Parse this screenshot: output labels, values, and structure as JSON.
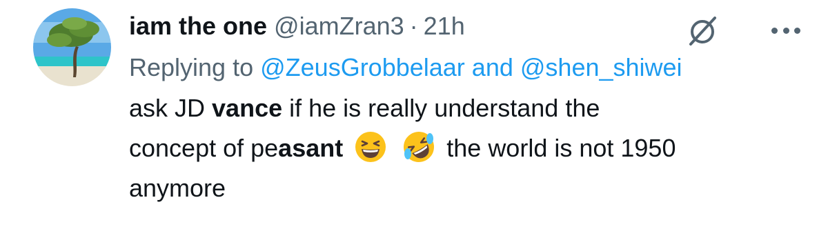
{
  "user": {
    "display_name": "iam the one",
    "handle": "@iamZran3",
    "separator": "·",
    "time": "21h"
  },
  "reply": {
    "prefix": "Replying to ",
    "mention1": "@ZeusGrobbelaar",
    "and": " and ",
    "mention2": "@shen_shiwei"
  },
  "body": {
    "t1": "ask JD ",
    "t2": "vance",
    "t3": " if he is really understand the",
    "t4": "concept of pe",
    "t5": "asant",
    "t6": " the world is not 1950",
    "t7": "anymore"
  },
  "icons": {
    "avatar": "avatar-beach-tree",
    "grok": "grok-icon",
    "more": "more-icon",
    "emoji1": "grinning-squinting-face",
    "emoji2": "rolling-on-the-floor-laughing"
  },
  "colors": {
    "text": "#0f1419",
    "secondary": "#536471",
    "link": "#1d9bf0"
  }
}
